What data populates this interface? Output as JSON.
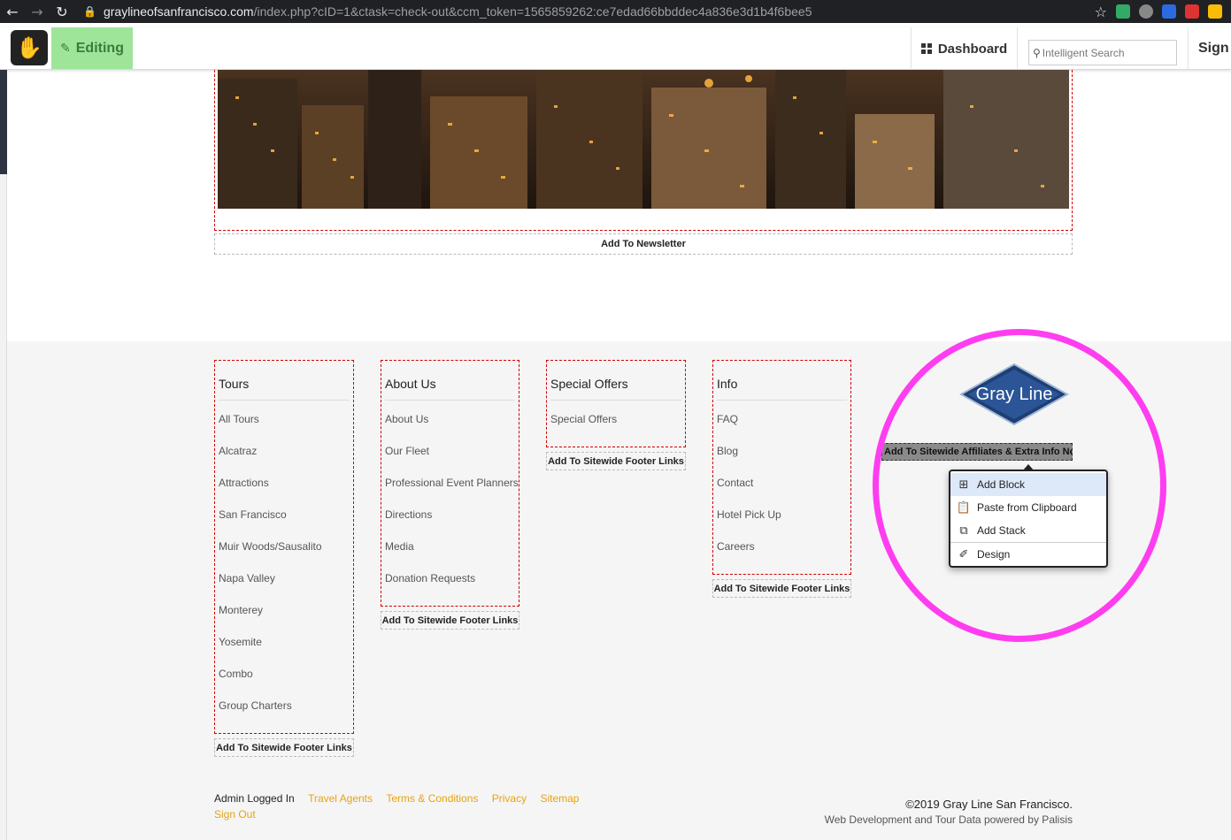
{
  "browser": {
    "url_host": "graylineofsanfrancisco.com",
    "url_path": "/index.php?cID=1&ctask=check-out&ccm_token=1565859262:ce7edad66bbddec4a836e3d1b4f6bee5"
  },
  "toolbar": {
    "editing_label": "Editing",
    "dashboard_label": "Dashboard",
    "search_placeholder": "Intelligent Search",
    "sign_label": "Sign Out"
  },
  "content": {
    "newsletter_label": "Add To Newsletter"
  },
  "footer": {
    "columns": [
      {
        "title": "Tours",
        "links": [
          "All Tours",
          "Alcatraz",
          "Attractions",
          "San Francisco",
          "Muir Woods/Sausalito",
          "Napa Valley",
          "Monterey",
          "Yosemite",
          "Combo",
          "Group Charters"
        ],
        "add_label": "Add To Sitewide Footer Links"
      },
      {
        "title": "About Us",
        "links": [
          "About Us",
          "Our Fleet",
          "Professional Event Planners",
          "Directions",
          "Media",
          "Donation Requests"
        ],
        "add_label": "Add To Sitewide Footer Links"
      },
      {
        "title": "Special Offers",
        "links": [
          "Special Offers"
        ],
        "add_label": "Add To Sitewide Footer Links"
      },
      {
        "title": "Info",
        "links": [
          "FAQ",
          "Blog",
          "Contact",
          "Hotel Pick Up",
          "Careers"
        ],
        "add_label": "Add To Sitewide Footer Links"
      }
    ],
    "logo_text": "Gray Line",
    "affiliates_label": "Add To Sitewide Affiliates & Extra Info Ne",
    "context_menu": [
      "Add Block",
      "Paste from Clipboard",
      "Add Stack",
      "Design"
    ],
    "admin_text": "Admin Logged In",
    "bottom_links": [
      "Travel Agents",
      "Terms & Conditions",
      "Privacy",
      "Sitemap"
    ],
    "signout": "Sign Out",
    "copyright": "©2019 Gray Line San Francisco.",
    "powered_by": "Web Development and Tour Data powered by Palisis"
  },
  "colors": {
    "editing_bg": "#9ee59a",
    "link_orange": "#e8a312",
    "highlight_ring": "#ff3df0",
    "menu_highlight": "#dde9f9"
  }
}
